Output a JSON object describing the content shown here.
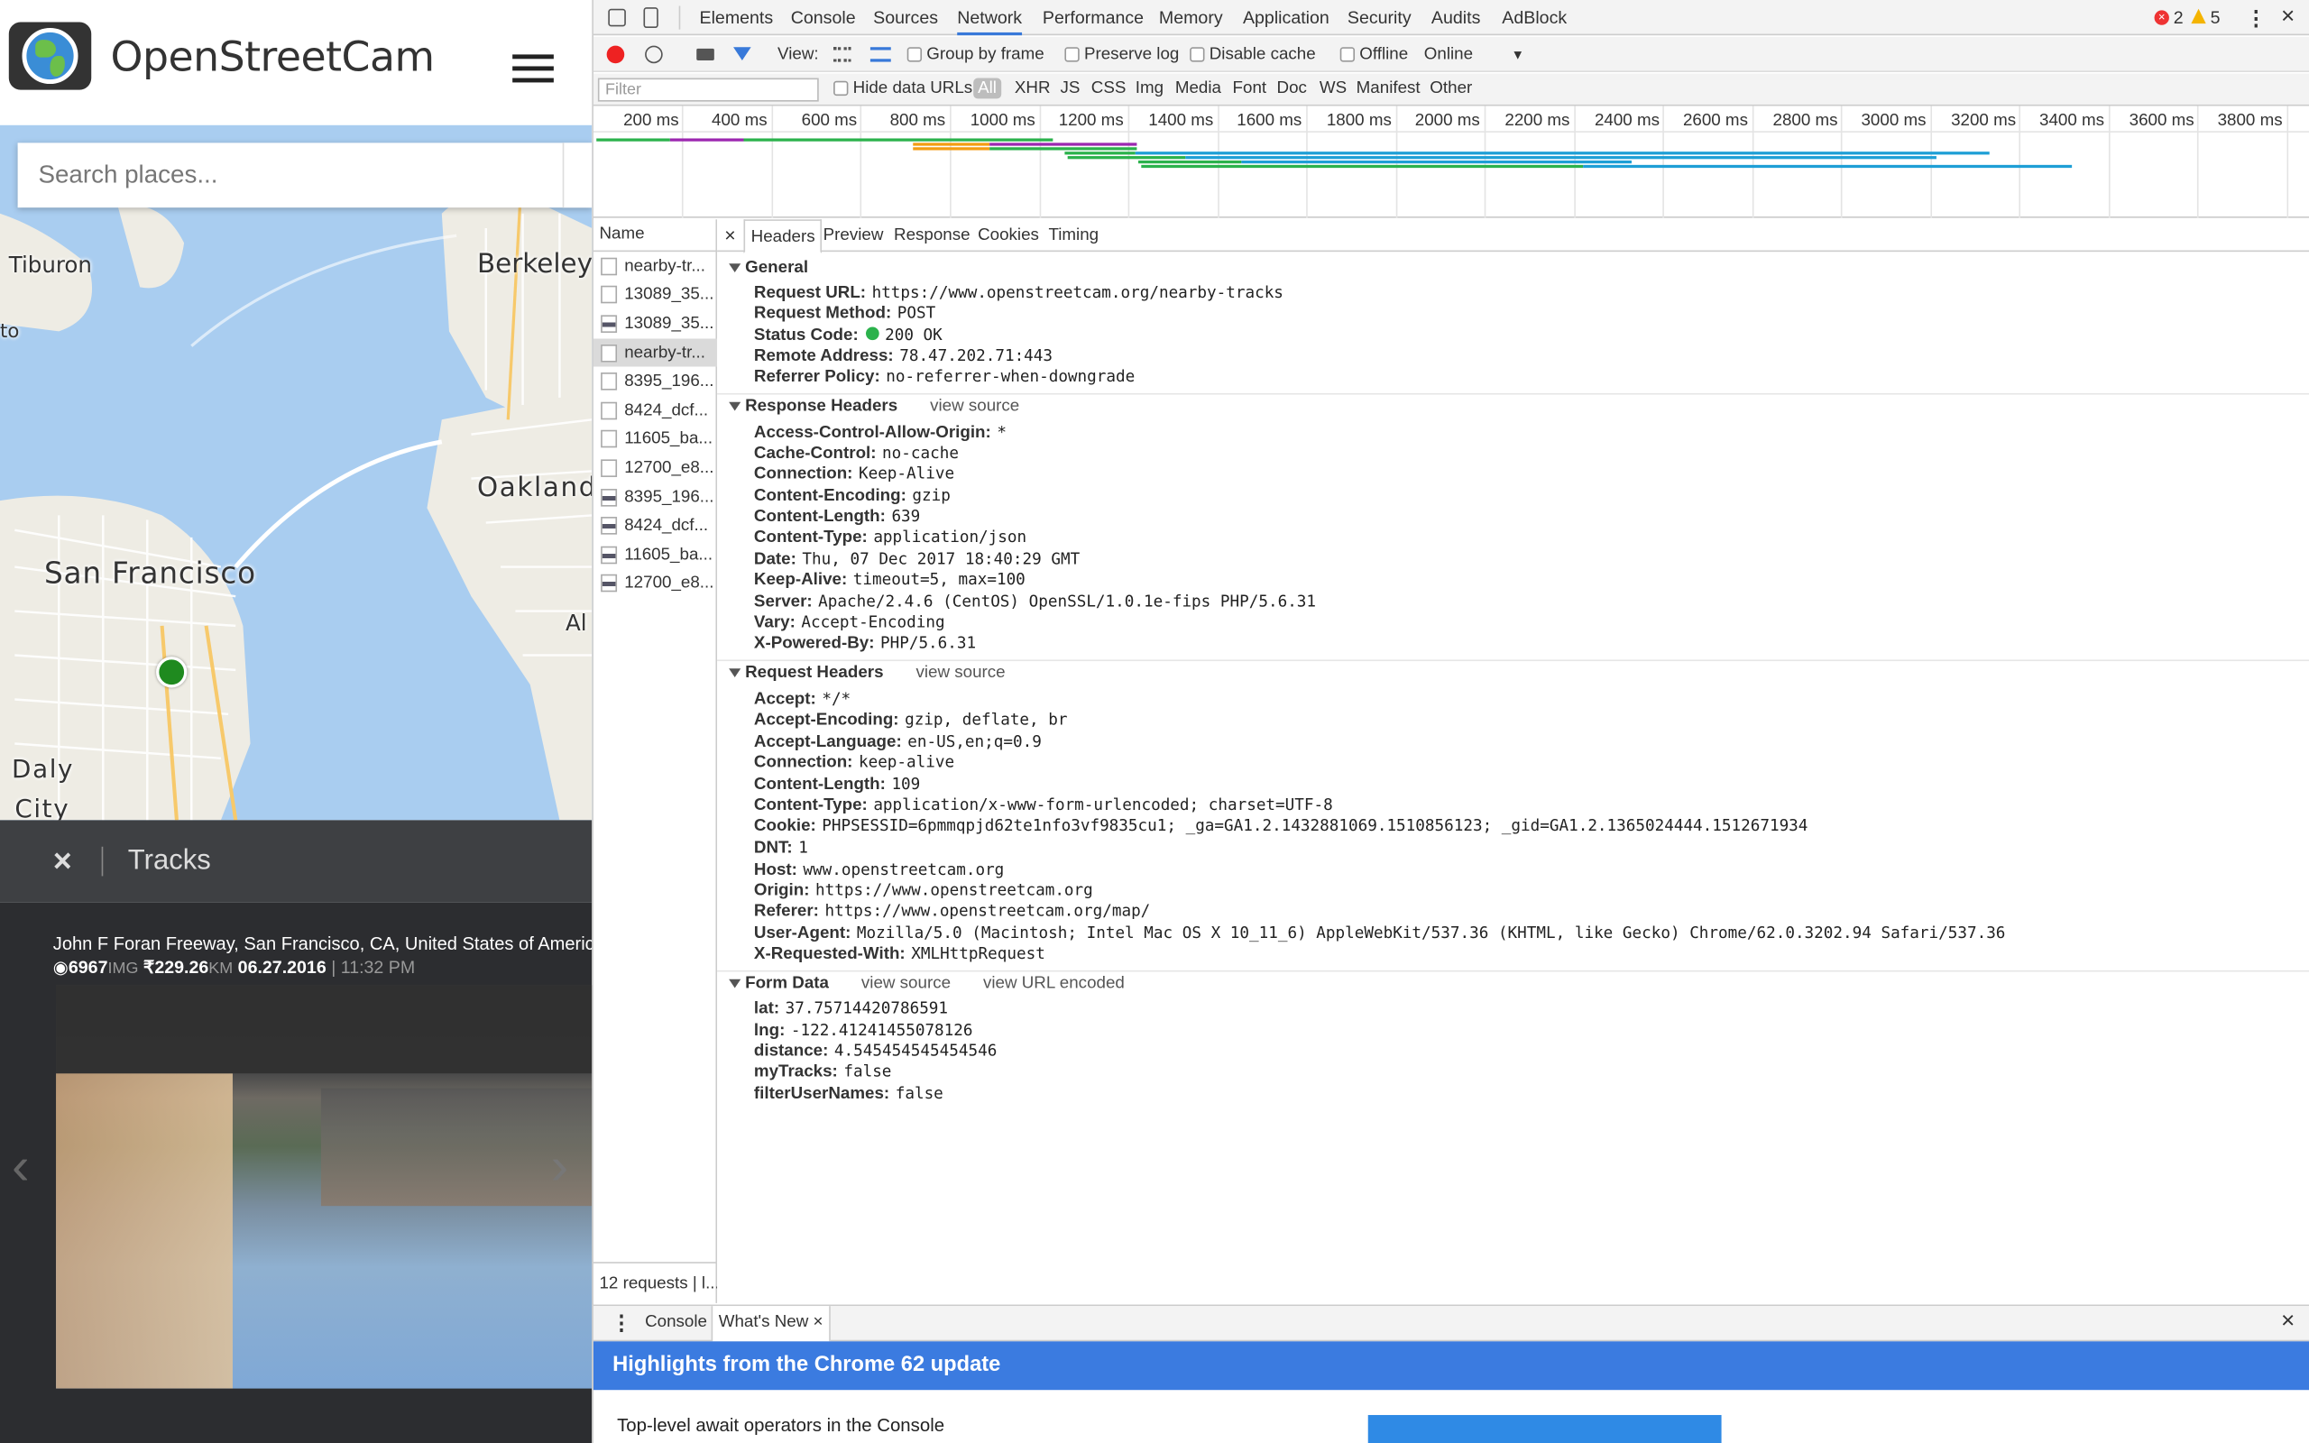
{
  "app": {
    "brand": "OpenStreetCam",
    "search_placeholder": "Search places...",
    "map_labels": {
      "tiburon": "Tiburon",
      "to": "to",
      "berkeley": "Berkeley",
      "oakland": "Oakland",
      "sf": "San Francisco",
      "al": "Al",
      "daly": "Daly",
      "city": "City"
    },
    "tracks_title": "Tracks",
    "track": {
      "title": "John F Foran Freeway, San Francisco, CA, United States of America, US",
      "images": "6967",
      "images_unit": "IMG",
      "distance": "₹229.26",
      "distance_unit": "KM",
      "date": "06.27.2016",
      "time": "11:32 PM"
    }
  },
  "devtools": {
    "tabs": [
      "Elements",
      "Console",
      "Sources",
      "Network",
      "Performance",
      "Memory",
      "Application",
      "Security",
      "Audits",
      "AdBlock"
    ],
    "active_tab": "Network",
    "errors": "2",
    "warnings": "5",
    "toolbar": {
      "view": "View:",
      "group_by_frame": "Group by frame",
      "preserve_log": "Preserve log",
      "disable_cache": "Disable cache",
      "offline": "Offline",
      "online": "Online"
    },
    "filter": {
      "placeholder": "Filter",
      "hide_data_urls": "Hide data URLs",
      "types": [
        "All",
        "XHR",
        "JS",
        "CSS",
        "Img",
        "Media",
        "Font",
        "Doc",
        "WS",
        "Manifest",
        "Other"
      ]
    },
    "ticks": [
      "200 ms",
      "400 ms",
      "600 ms",
      "800 ms",
      "1000 ms",
      "1200 ms",
      "1400 ms",
      "1600 ms",
      "1800 ms",
      "2000 ms",
      "2200 ms",
      "2400 ms",
      "2600 ms",
      "2800 ms",
      "3000 ms",
      "3200 ms",
      "3400 ms",
      "3600 ms",
      "3800 ms"
    ],
    "name_header": "Name",
    "requests": [
      "nearby-tr...",
      "13089_35...",
      "13089_35...",
      "nearby-tr...",
      "8395_196...",
      "8424_dcf...",
      "11605_ba...",
      "12700_e8...",
      "8395_196...",
      "8424_dcf...",
      "11605_ba...",
      "12700_e8..."
    ],
    "summary": "12 requests | l...",
    "detail_tabs": [
      "Headers",
      "Preview",
      "Response",
      "Cookies",
      "Timing"
    ],
    "general": {
      "title": "General",
      "rows": [
        [
          "Request URL:",
          "https://www.openstreetcam.org/nearby-tracks"
        ],
        [
          "Request Method:",
          "POST"
        ],
        [
          "Status Code:",
          "200 OK"
        ],
        [
          "Remote Address:",
          "78.47.202.71:443"
        ],
        [
          "Referrer Policy:",
          "no-referrer-when-downgrade"
        ]
      ]
    },
    "response_headers": {
      "title": "Response Headers",
      "view_source": "view source",
      "rows": [
        [
          "Access-Control-Allow-Origin:",
          "*"
        ],
        [
          "Cache-Control:",
          "no-cache"
        ],
        [
          "Connection:",
          "Keep-Alive"
        ],
        [
          "Content-Encoding:",
          "gzip"
        ],
        [
          "Content-Length:",
          "639"
        ],
        [
          "Content-Type:",
          "application/json"
        ],
        [
          "Date:",
          "Thu, 07 Dec 2017 18:40:29 GMT"
        ],
        [
          "Keep-Alive:",
          "timeout=5, max=100"
        ],
        [
          "Server:",
          "Apache/2.4.6 (CentOS) OpenSSL/1.0.1e-fips PHP/5.6.31"
        ],
        [
          "Vary:",
          "Accept-Encoding"
        ],
        [
          "X-Powered-By:",
          "PHP/5.6.31"
        ]
      ]
    },
    "request_headers": {
      "title": "Request Headers",
      "view_source": "view source",
      "rows": [
        [
          "Accept:",
          "*/*"
        ],
        [
          "Accept-Encoding:",
          "gzip, deflate, br"
        ],
        [
          "Accept-Language:",
          "en-US,en;q=0.9"
        ],
        [
          "Connection:",
          "keep-alive"
        ],
        [
          "Content-Length:",
          "109"
        ],
        [
          "Content-Type:",
          "application/x-www-form-urlencoded; charset=UTF-8"
        ],
        [
          "Cookie:",
          "PHPSESSID=6pmmqpjd62te1nfo3vf9835cu1; _ga=GA1.2.1432881069.1510856123; _gid=GA1.2.1365024444.1512671934"
        ],
        [
          "DNT:",
          "1"
        ],
        [
          "Host:",
          "www.openstreetcam.org"
        ],
        [
          "Origin:",
          "https://www.openstreetcam.org"
        ],
        [
          "Referer:",
          "https://www.openstreetcam.org/map/"
        ],
        [
          "User-Agent:",
          "Mozilla/5.0 (Macintosh; Intel Mac OS X 10_11_6) AppleWebKit/537.36 (KHTML, like Gecko) Chrome/62.0.3202.94 Safari/537.36"
        ],
        [
          "X-Requested-With:",
          "XMLHttpRequest"
        ]
      ]
    },
    "form_data": {
      "title": "Form Data",
      "view_source": "view source",
      "view_url_encoded": "view URL encoded",
      "rows": [
        [
          "lat:",
          "37.75714420786591"
        ],
        [
          "lng:",
          "-122.41241455078126"
        ],
        [
          "distance:",
          "4.545454545454546"
        ],
        [
          "myTracks:",
          "false"
        ],
        [
          "filterUserNames:",
          "false"
        ]
      ]
    },
    "drawer": {
      "tabs": [
        "Console",
        "What's New"
      ],
      "banner": "Highlights from the Chrome 62 update",
      "item": "Top-level await operators in the Console"
    },
    "colors": {
      "banner": "#3b7be0",
      "status_ok": "#2bb24c",
      "error": "#e33",
      "warning": "#f4b400"
    }
  }
}
